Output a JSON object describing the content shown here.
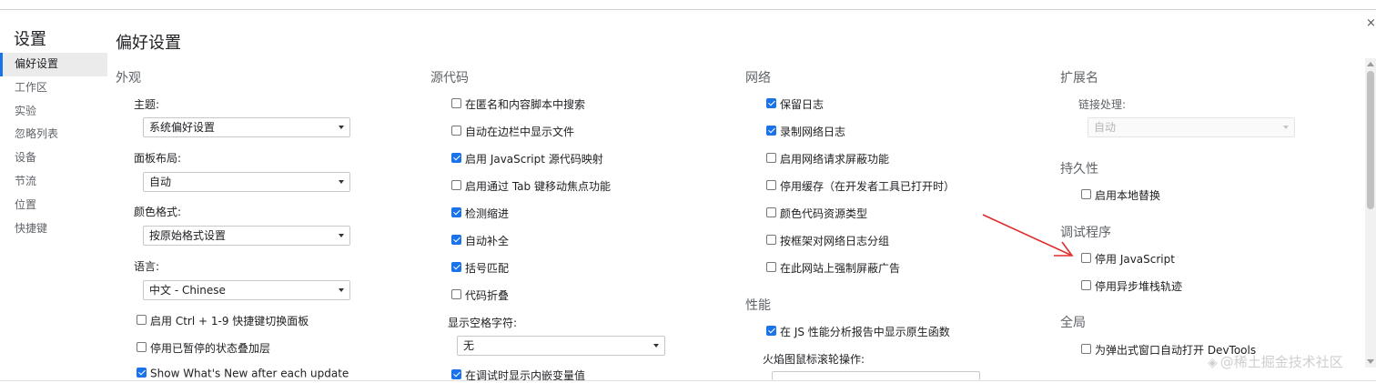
{
  "colors": {
    "accent": "#1a73e8",
    "annotation": "#e02b2b"
  },
  "close_icon": "×",
  "sidebar": {
    "title": "设置",
    "items": [
      {
        "label": "偏好设置"
      },
      {
        "label": "工作区"
      },
      {
        "label": "实验"
      },
      {
        "label": "忽略列表"
      },
      {
        "label": "设备"
      },
      {
        "label": "节流"
      },
      {
        "label": "位置"
      },
      {
        "label": "快捷键"
      }
    ]
  },
  "page_title": "偏好设置",
  "appearance": {
    "title": "外观",
    "theme": {
      "label": "主题:",
      "value": "系统偏好设置"
    },
    "panel_layout": {
      "label": "面板布局:",
      "value": "自动"
    },
    "color_format": {
      "label": "颜色格式:",
      "value": "按原始格式设置"
    },
    "language": {
      "label": "语言:",
      "value": "中文 - Chinese"
    },
    "checks": [
      {
        "label": "启用 Ctrl + 1-9 快捷键切换面板",
        "checked": false
      },
      {
        "label": "停用已暂停的状态叠加层",
        "checked": false
      },
      {
        "label": "Show What's New after each update",
        "checked": true
      }
    ]
  },
  "sources": {
    "title": "源代码",
    "checks": [
      {
        "label": "在匿名和内容脚本中搜索",
        "checked": false
      },
      {
        "label": "自动在边栏中显示文件",
        "checked": false
      },
      {
        "label": "启用 JavaScript 源代码映射",
        "checked": true
      },
      {
        "label": "启用通过 Tab 键移动焦点功能",
        "checked": false
      },
      {
        "label": "检测缩进",
        "checked": true
      },
      {
        "label": "自动补全",
        "checked": true
      },
      {
        "label": "括号匹配",
        "checked": true
      },
      {
        "label": "代码折叠",
        "checked": false
      }
    ],
    "whitespace": {
      "label": "显示空格字符:",
      "value": "无"
    },
    "trailing_check": {
      "label": "在调试时显示内嵌变量值",
      "checked": true
    }
  },
  "network": {
    "title": "网络",
    "checks": [
      {
        "label": "保留日志",
        "checked": true
      },
      {
        "label": "录制网络日志",
        "checked": true
      },
      {
        "label": "启用网络请求屏蔽功能",
        "checked": false
      },
      {
        "label": "停用缓存（在开发者工具已打开时）",
        "checked": false
      },
      {
        "label": "颜色代码资源类型",
        "checked": false
      },
      {
        "label": "按框架对网络日志分组",
        "checked": false
      },
      {
        "label": "在此网站上强制屏蔽广告",
        "checked": false
      }
    ]
  },
  "performance": {
    "title": "性能",
    "checks": [
      {
        "label": "在 JS 性能分析报告中显示原生函数",
        "checked": true
      }
    ],
    "flame_label": "火焰图鼠标滚轮操作:"
  },
  "extensions": {
    "title": "扩展名",
    "link_handling": {
      "label": "链接处理:",
      "value": "自动"
    }
  },
  "persistence": {
    "title": "持久性",
    "checks": [
      {
        "label": "启用本地替换",
        "checked": false
      }
    ]
  },
  "debugger": {
    "title": "调试程序",
    "checks": [
      {
        "label": "停用 JavaScript",
        "checked": false
      },
      {
        "label": "停用异步堆栈轨迹",
        "checked": false
      }
    ]
  },
  "global": {
    "title": "全局",
    "checks": [
      {
        "label": "为弹出式窗口自动打开 DevTools",
        "checked": false
      }
    ]
  },
  "watermark": "@稀土掘金技术社区"
}
